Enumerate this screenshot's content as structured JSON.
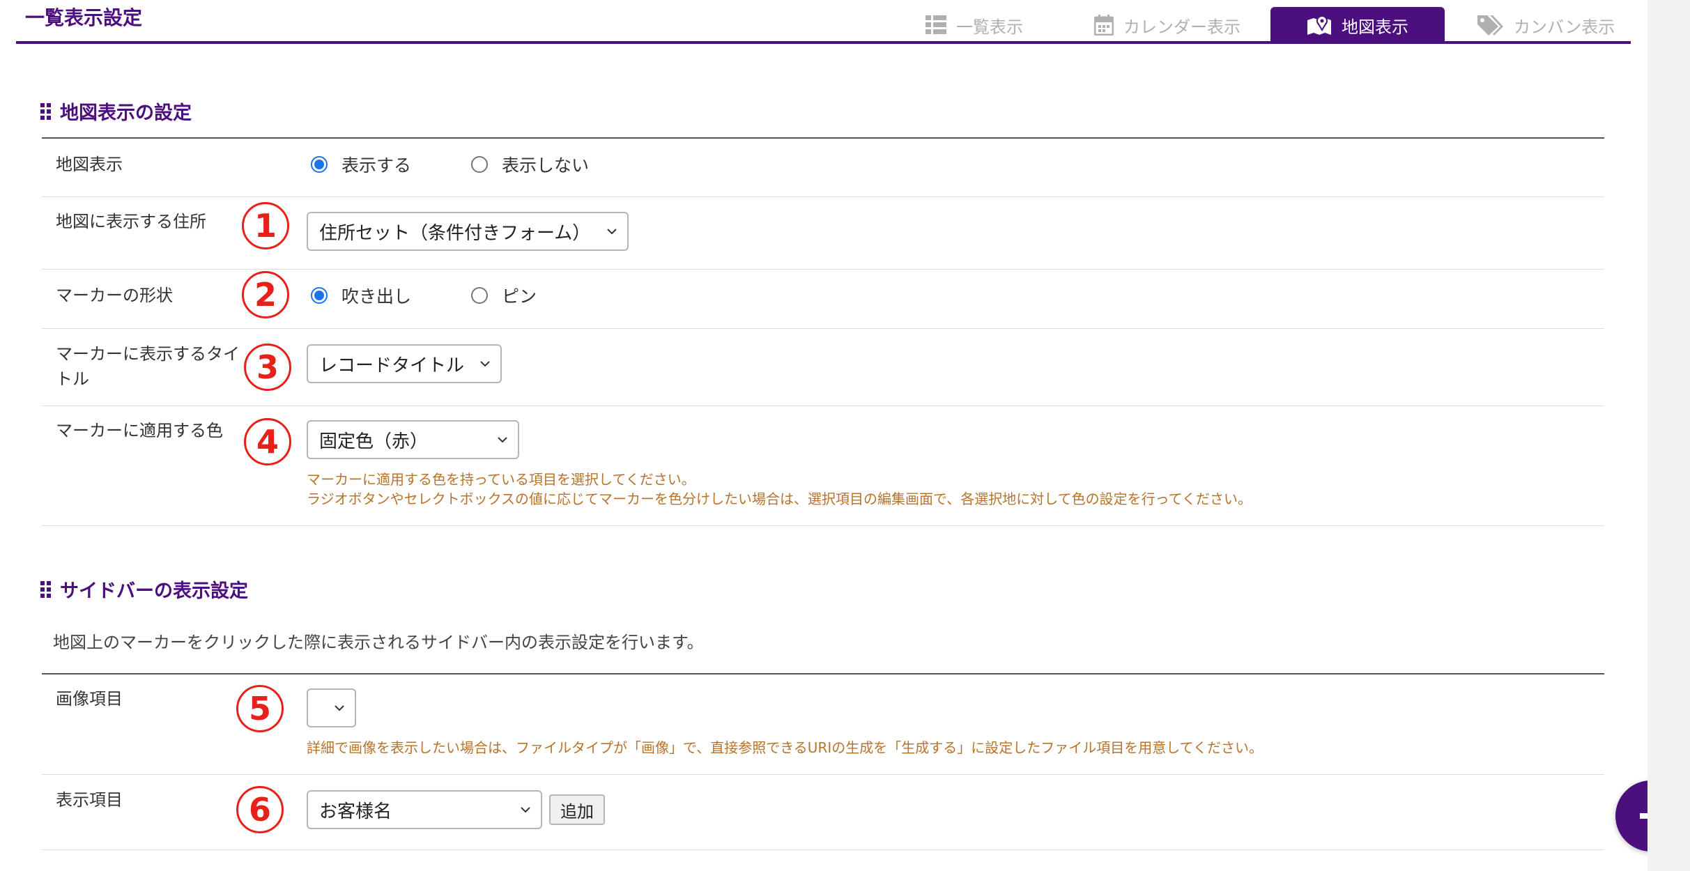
{
  "header": {
    "title": "一覧表示設定",
    "tabs": [
      {
        "label": "一覧表示",
        "icon": "list-icon",
        "active": false
      },
      {
        "label": "カレンダー表示",
        "icon": "calendar-icon",
        "active": false
      },
      {
        "label": "地図表示",
        "icon": "map-icon",
        "active": true
      },
      {
        "label": "カンバン表示",
        "icon": "tag-icon",
        "active": false
      }
    ]
  },
  "map_section": {
    "heading": "地図表示の設定",
    "rows": {
      "map_display": {
        "label": "地図表示",
        "options": [
          "表示する",
          "表示しない"
        ],
        "selected": "表示する"
      },
      "address": {
        "marker": "1",
        "label": "地図に表示する住所",
        "value": "住所セット（条件付きフォーム）"
      },
      "marker_shape": {
        "marker": "2",
        "label": "マーカーの形状",
        "options": [
          "吹き出し",
          "ピン"
        ],
        "selected": "吹き出し"
      },
      "marker_title": {
        "marker": "3",
        "label": "マーカーに表示するタイトル",
        "value": "レコードタイトル"
      },
      "marker_color": {
        "marker": "4",
        "label": "マーカーに適用する色",
        "value": "固定色（赤）",
        "note_line1": "マーカーに適用する色を持っている項目を選択してください。",
        "note_line2": "ラジオボタンやセレクトボックスの値に応じてマーカーを色分けしたい場合は、選択項目の編集画面で、各選択地に対して色の設定を行ってください。"
      }
    }
  },
  "sidebar_section": {
    "heading": "サイドバーの表示設定",
    "description": "地図上のマーカーをクリックした際に表示されるサイドバー内の表示設定を行います。",
    "rows": {
      "image_item": {
        "marker": "5",
        "label": "画像項目",
        "value": "",
        "note": "詳細で画像を表示したい場合は、ファイルタイプが「画像」で、直接参照できるURIの生成を「生成する」に設定したファイル項目を用意してください。"
      },
      "display_item": {
        "marker": "6",
        "label": "表示項目",
        "value": "お客様名",
        "add_label": "追加"
      }
    }
  },
  "fab": {
    "icon": "plus-icon"
  },
  "colors": {
    "brand": "#4b0f7e",
    "annotation_red": "#e8201a",
    "note_text": "#b8732a",
    "radio_selected": "#1a73e8"
  }
}
